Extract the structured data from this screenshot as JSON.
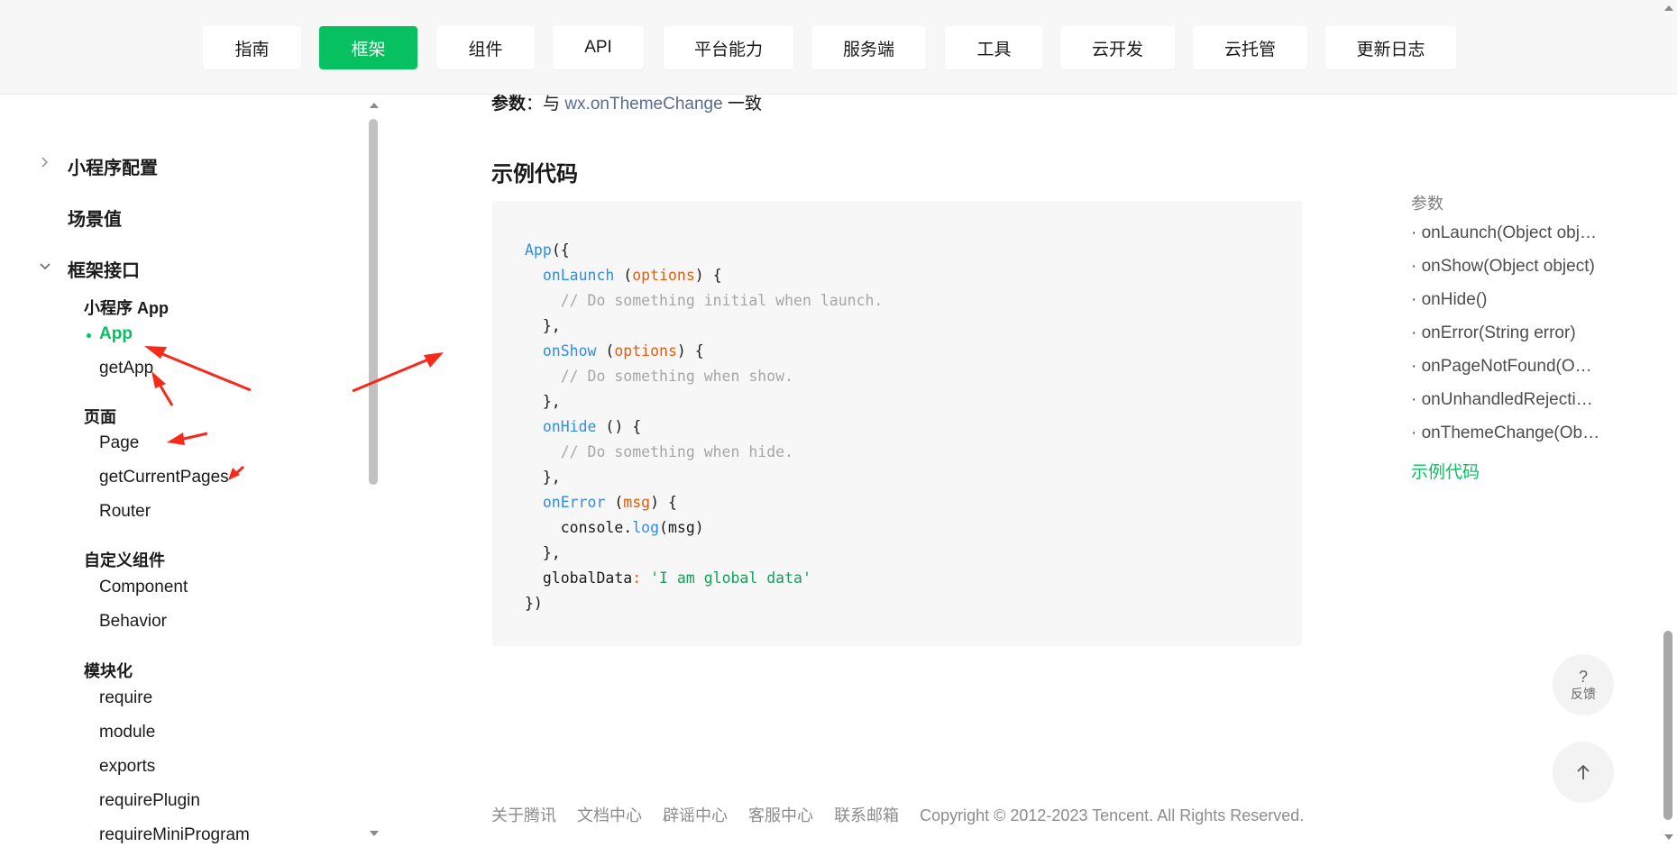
{
  "nav": {
    "items": [
      {
        "label": "指南",
        "active": false
      },
      {
        "label": "框架",
        "active": true
      },
      {
        "label": "组件",
        "active": false
      },
      {
        "label": "API",
        "active": false
      },
      {
        "label": "平台能力",
        "active": false
      },
      {
        "label": "服务端",
        "active": false
      },
      {
        "label": "工具",
        "active": false
      },
      {
        "label": "云开发",
        "active": false
      },
      {
        "label": "云托管",
        "active": false
      },
      {
        "label": "更新日志",
        "active": false
      }
    ]
  },
  "sidebar": {
    "sections": [
      {
        "title": "小程序配置",
        "state": "collapsed"
      },
      {
        "title": "场景值",
        "state": "none"
      },
      {
        "title": "框架接口",
        "state": "expanded"
      }
    ],
    "groups": [
      {
        "title": "小程序 App",
        "items": [
          {
            "label": "App",
            "active": true
          },
          {
            "label": "getApp"
          }
        ]
      },
      {
        "title": "页面",
        "items": [
          {
            "label": "Page"
          },
          {
            "label": "getCurrentPages"
          },
          {
            "label": "Router"
          }
        ]
      },
      {
        "title": "自定义组件",
        "items": [
          {
            "label": "Component"
          },
          {
            "label": "Behavior"
          }
        ]
      },
      {
        "title": "模块化",
        "items": [
          {
            "label": "require"
          },
          {
            "label": "module"
          },
          {
            "label": "exports"
          },
          {
            "label": "requirePlugin"
          },
          {
            "label": "requireMiniProgram"
          }
        ]
      }
    ]
  },
  "main": {
    "param_label": "参数",
    "param_colon": "：",
    "param_prefix": "与",
    "param_link": "wx.onThemeChange",
    "param_suffix": "一致",
    "example_heading": "示例代码",
    "code": {
      "app": "App",
      "open": "({",
      "onLaunch": "onLaunch",
      "options": "options",
      "launch_comment": "// Do something initial when launch.",
      "onShow": "onShow",
      "show_comment": "// Do something when show.",
      "onHide": "onHide",
      "hide_comment": "// Do something when hide.",
      "onError": "onError",
      "msg": "msg",
      "console": "console.",
      "log": "log",
      "globalData": "globalData",
      "global_value": "'I am global data'",
      "close": "})"
    }
  },
  "toc": {
    "title": "参数",
    "items": [
      "· onLaunch(Object object)",
      "· onShow(Object object)",
      "· onHide()",
      "· onError(String error)",
      "· onPageNotFound(Object object)",
      "· onUnhandledRejection(Object object)",
      "· onThemeChange(Object object)"
    ],
    "active": "示例代码"
  },
  "floating": {
    "feedback_icon": "?",
    "feedback_label": "反馈",
    "top_icon": "arrow-up-icon"
  },
  "footer": {
    "links": [
      "关于腾讯",
      "文档中心",
      "辟谣中心",
      "客服中心",
      "联系邮箱"
    ],
    "copyright": "Copyright © 2012-2023 Tencent. All Rights Reserved."
  },
  "colors": {
    "brand": "#07c160",
    "link": "#576b95",
    "annotation": "#f52a1a"
  }
}
